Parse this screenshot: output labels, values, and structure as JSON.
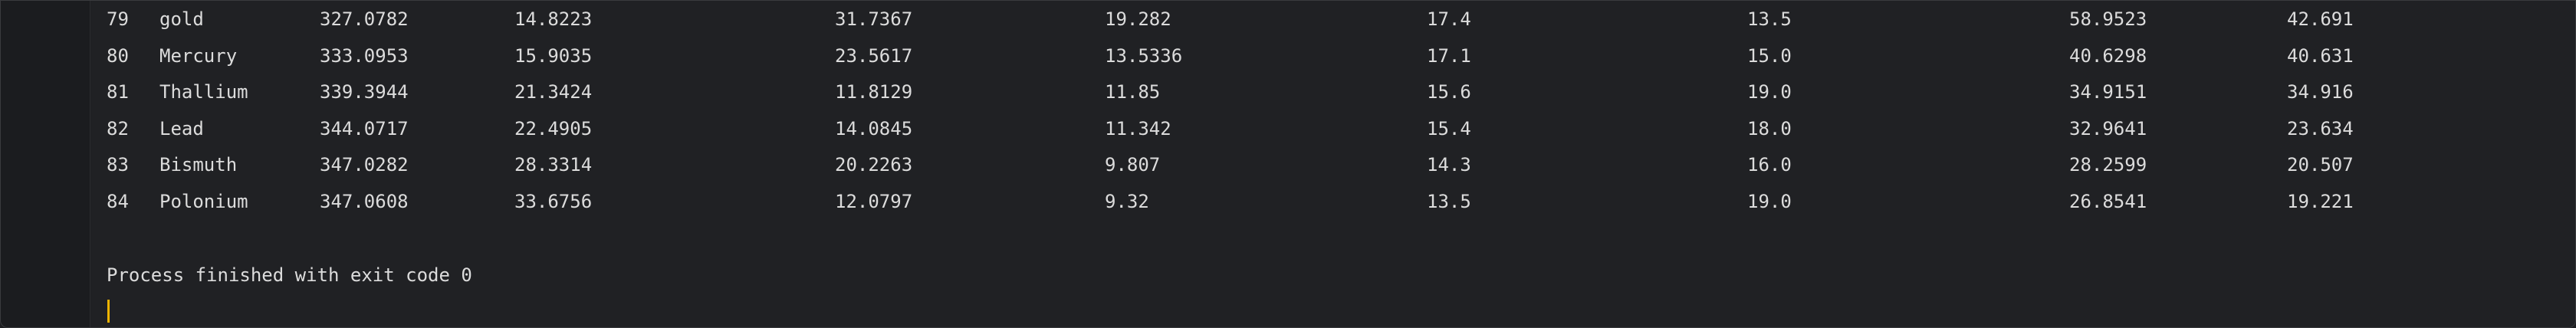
{
  "console": {
    "rows": [
      [
        "79",
        "gold",
        "327.0782",
        "14.8223",
        "31.7367",
        "19.282",
        "17.4",
        "13.5",
        "58.9523",
        "42.691"
      ],
      [
        "80",
        "Mercury",
        "333.0953",
        "15.9035",
        "23.5617",
        "13.5336",
        "17.1",
        "15.0",
        "40.6298",
        "40.631"
      ],
      [
        "81",
        "Thallium",
        "339.3944",
        "21.3424",
        "11.8129",
        "11.85",
        "15.6",
        "19.0",
        "34.9151",
        "34.916"
      ],
      [
        "82",
        "Lead",
        "344.0717",
        "22.4905",
        "14.0845",
        "11.342",
        "15.4",
        "18.0",
        "32.9641",
        "23.634"
      ],
      [
        "83",
        "Bismuth",
        "347.0282",
        "28.3314",
        "20.2263",
        "9.807",
        "14.3",
        "16.0",
        "28.2599",
        "20.507"
      ],
      [
        "84",
        "Polonium",
        "347.0608",
        "33.6756",
        "12.0797",
        "9.32",
        "13.5",
        "19.0",
        "26.8541",
        "19.221"
      ]
    ],
    "status": "Process finished with exit code 0"
  },
  "colors": {
    "background": "#202124",
    "text": "#dcdcdc",
    "caret": "#f0b400"
  }
}
